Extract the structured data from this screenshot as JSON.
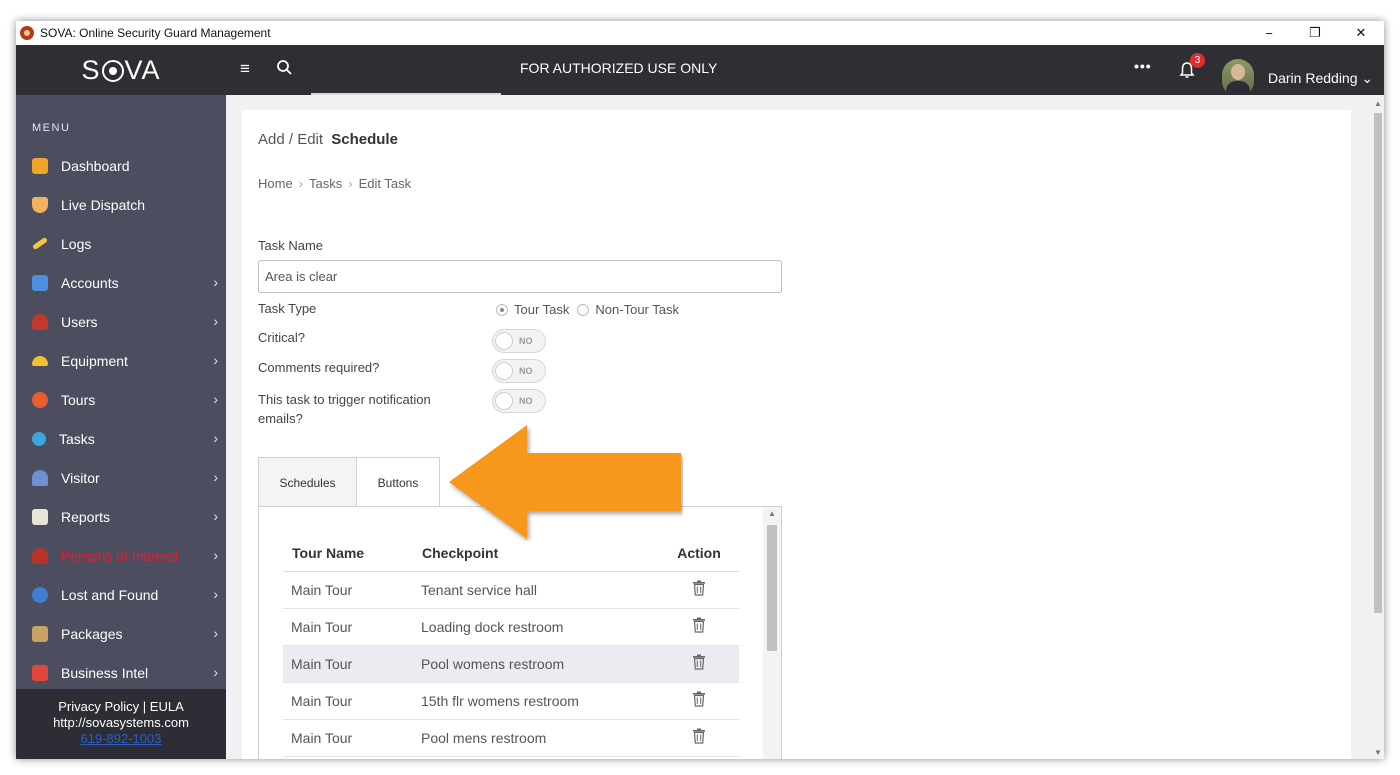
{
  "window": {
    "title": "SOVA: Online Security Guard Management",
    "controls": {
      "minimize": "−",
      "restore": "❐",
      "close": "✕"
    }
  },
  "topbar": {
    "logo": {
      "before": "S",
      "after": "VA"
    },
    "menu_icon": "≡",
    "banner": "FOR AUTHORIZED USE ONLY",
    "more": "•••",
    "notification_count": "3",
    "user_name": "Darin Redding",
    "user_chevron": "⌄"
  },
  "sidebar": {
    "heading": "MENU",
    "chevron": "›",
    "items": [
      {
        "label": "Dashboard",
        "icon": "home-icon",
        "color": "#f0a428"
      },
      {
        "label": "Live Dispatch",
        "icon": "shield-icon",
        "color": "#f0b25a"
      },
      {
        "label": "Logs",
        "icon": "pencil-icon",
        "color": "#f4c542"
      },
      {
        "label": "Accounts",
        "icon": "building-icon",
        "color": "#4a8fe0"
      },
      {
        "label": "Users",
        "icon": "user-icon",
        "color": "#c0392b"
      },
      {
        "label": "Equipment",
        "icon": "hardhat-icon",
        "color": "#f2c12e"
      },
      {
        "label": "Tours",
        "icon": "compass-icon",
        "color": "#e95c2d"
      },
      {
        "label": "Tasks",
        "icon": "gear-icon",
        "color": "#3aa8e0"
      },
      {
        "label": "Visitor",
        "icon": "visitor-icon",
        "color": "#6e8fd0"
      },
      {
        "label": "Reports",
        "icon": "clipboard-icon",
        "color": "#e9e4d8"
      },
      {
        "label": "Persons of Interest",
        "icon": "suspect-icon",
        "color": "#b83227"
      },
      {
        "label": "Lost and Found",
        "icon": "target-icon",
        "color": "#3f7fcf"
      },
      {
        "label": "Packages",
        "icon": "package-icon",
        "color": "#c9a162"
      },
      {
        "label": "Business Intel",
        "icon": "cubes-icon",
        "color": "#e2453a"
      }
    ],
    "footer": {
      "privacy": "Privacy Policy",
      "divider": "|",
      "eula": "EULA",
      "website": "http://sovasystems.com",
      "phone": "619-892-1003"
    }
  },
  "main": {
    "title_prefix": "Add / Edit",
    "title_bold": "Schedule",
    "breadcrumb": [
      "Home",
      "Tasks",
      "Edit Task"
    ],
    "breadcrumb_sep": "›",
    "task_name_label": "Task Name",
    "task_name_value": "Area is clear",
    "task_type_label": "Task Type",
    "task_type_options": [
      "Tour Task",
      "Non-Tour Task"
    ],
    "critical_label": "Critical?",
    "comments_label": "Comments required?",
    "notify_label": "This task to trigger notification emails?",
    "toggle_text": "NO",
    "tabs": [
      "Schedules",
      "Buttons"
    ],
    "table": {
      "headers": [
        "Tour Name",
        "Checkpoint",
        "Action"
      ],
      "rows": [
        [
          "Main Tour",
          "Tenant service hall"
        ],
        [
          "Main Tour",
          "Loading dock restroom"
        ],
        [
          "Main Tour",
          "Pool womens restroom"
        ],
        [
          "Main Tour",
          "15th flr womens restroom"
        ],
        [
          "Main Tour",
          "Pool mens restroom"
        ]
      ]
    }
  },
  "colors": {
    "topbar": "#2f2f33",
    "sidebar": "#4c4d5f",
    "highlight_row": "#ebebf2",
    "arrow": "#f7981d",
    "badge": "#e02d2d"
  }
}
